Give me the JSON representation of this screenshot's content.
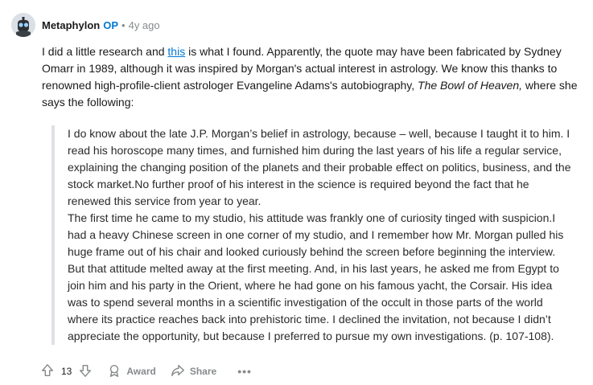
{
  "comment": {
    "author": "Metaphylon",
    "op_badge": "OP",
    "separator": "•",
    "timestamp": "4y ago",
    "intro": {
      "part1": "I did a little research and ",
      "link_text": "this",
      "part2": " is what I found. Apparently, the quote may have been fabricated by Sydney Omarr in 1989, although it was inspired by Morgan's actual interest in astrology. We know this thanks to renowned high-profile-client astrologer Evangeline Adams's autobiography, ",
      "book_title": "The Bowl of Heaven,",
      "part3": " where she says the following:"
    },
    "quote": [
      "I do know about the late J.P. Morgan’s belief in astrology, because – well, because I taught it to him. I read his horoscope many times, and furnished him during the last years of his life a regular service, explaining the changing position of the planets and their probable effect on politics, business, and the stock market.No further proof of his interest in the science is required beyond the fact that he renewed this service from year to year.",
      "The first time he came to my studio, his attitude was frankly one of curiosity tinged with suspicion.I had a heavy Chinese screen in one corner of my studio, and I remember how Mr. Morgan pulled his huge frame out of his chair and looked curiously behind the screen before beginning the interview. But that attitude melted away at the first meeting. And, in his last years, he asked me from Egypt to join him and his party in the Orient, where he had gone on his famous yacht, the Corsair. His idea was to spend several months in a scientific investigation of the occult in those parts of the world where its practice reaches back into prehistoric time. I declined the invitation, not because I didn’t appreciate the opportunity, but because I preferred to pursue my own investigations. (p. 107-108)."
    ]
  },
  "actions": {
    "vote_count": "13",
    "award_label": "Award",
    "share_label": "Share",
    "more_label": "•••"
  },
  "icons": {
    "upvote": "upvote-icon",
    "downvote": "downvote-icon",
    "award": "award-icon",
    "share": "share-icon"
  },
  "colors": {
    "op": "#0079d3",
    "link": "#0079d3",
    "muted": "#878a8c",
    "quote_border": "#dee1e3"
  }
}
